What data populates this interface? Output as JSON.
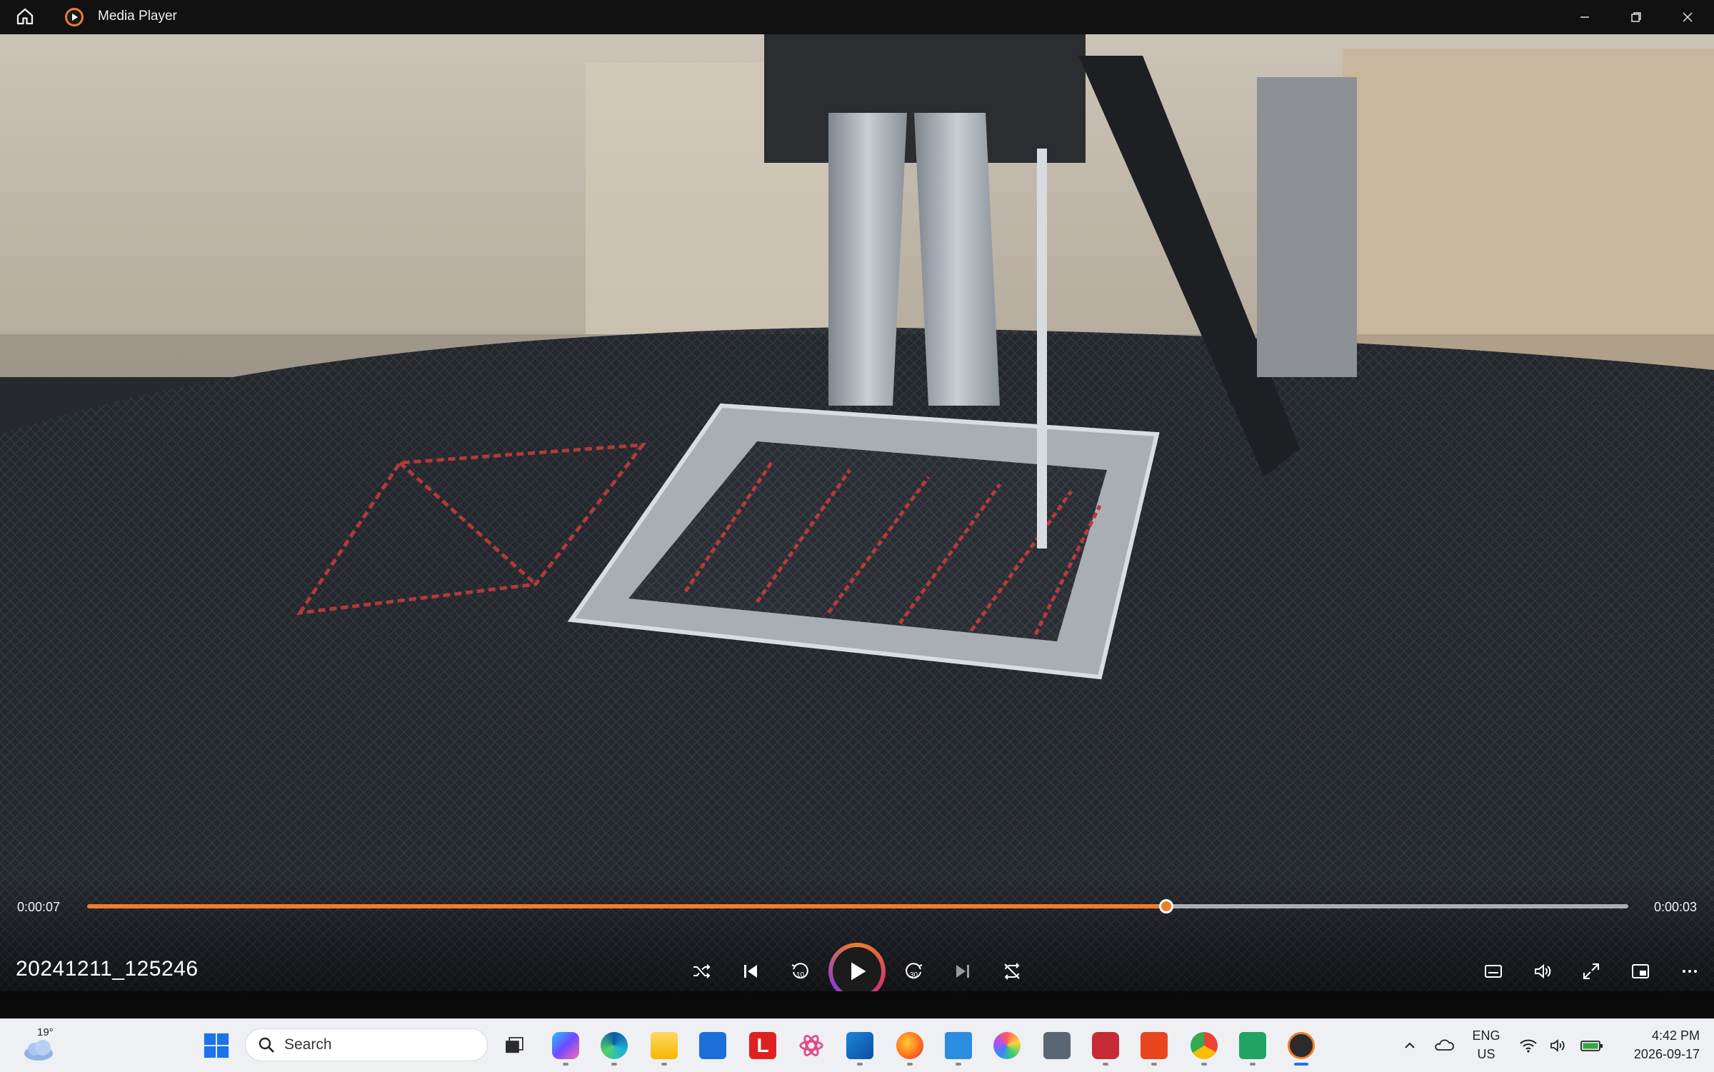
{
  "window": {
    "title": "Media Player"
  },
  "player": {
    "elapsed": "0:00:07",
    "remaining": "0:00:03",
    "progress_fraction": 0.7,
    "filename": "20241211_125246",
    "accent_color": "#f07c2c",
    "controls": {
      "shuffle": "shuffle-icon",
      "previous": "previous-icon",
      "rewind": "10",
      "play": "play-icon",
      "forward": "30",
      "next": "next-icon",
      "repeat": "repeat-off-icon",
      "captions": "captions-icon",
      "volume": "volume-icon",
      "fullscreen": "fullscreen-icon",
      "miniplayer": "miniplayer-icon",
      "more": "more-icon"
    }
  },
  "taskbar": {
    "weather_temp": "19°",
    "search_placeholder": "Search",
    "language_top": "ENG",
    "language_bottom": "US",
    "time": "4:42 PM",
    "date": "2026-09-17",
    "apps": [
      "start",
      "search",
      "task-view",
      "m365",
      "edge",
      "file-explorer",
      "store",
      "l-app",
      "atom",
      "outlook",
      "firefox",
      "notepad",
      "paint",
      "calculator",
      "access",
      "acrobat",
      "chrome",
      "sheets",
      "media-player"
    ]
  }
}
